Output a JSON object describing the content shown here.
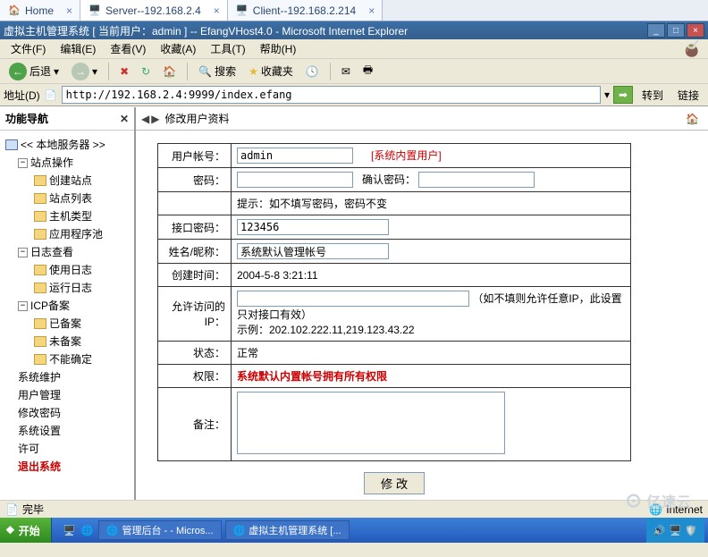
{
  "apptabs": {
    "home": "Home",
    "server": "Server--192.168.2.4",
    "client": "Client--192.168.2.214"
  },
  "titlebar": "虚拟主机管理系统 [ 当前用户：admin ] -- EfangVHost4.0 - Microsoft Internet Explorer",
  "menu": {
    "file": "文件(F)",
    "edit": "编辑(E)",
    "view": "查看(V)",
    "fav": "收藏(A)",
    "tools": "工具(T)",
    "help": "帮助(H)"
  },
  "toolbar": {
    "back": "后退",
    "stop": "",
    "refresh": "",
    "home": "",
    "search": "搜索",
    "fav": "收藏夹"
  },
  "addrbar": {
    "label": "地址(D)",
    "url": "http://192.168.2.4:9999/index.efang",
    "go": "转到",
    "links": "链接"
  },
  "leftpanel": {
    "title": "功能导航",
    "root": "<< 本地服务器 >>",
    "site_ops": "站点操作",
    "site_ops_items": [
      "创建站点",
      "站点列表",
      "主机类型",
      "应用程序池"
    ],
    "log": "日志查看",
    "log_items": [
      "使用日志",
      "运行日志"
    ],
    "icp": "ICP备案",
    "icp_items": [
      "已备案",
      "未备案",
      "不能确定"
    ],
    "flat": [
      "系统维护",
      "用户管理",
      "修改密码",
      "系统设置",
      "许可"
    ],
    "exit": "退出系统"
  },
  "rightpanel": {
    "title": "修改用户资料"
  },
  "form": {
    "user_label": "用户帐号：",
    "user_value": "admin",
    "builtin": "[系统内置用户]",
    "pwd_label": "密码：",
    "pwd2_label": "确认密码：",
    "pwd_hint": "提示：如不填写密码，密码不变",
    "api_label": "接口密码：",
    "api_value": "123456",
    "name_label": "姓名/昵称：",
    "name_value": "系统默认管理帐号",
    "create_label": "创建时间：",
    "create_value": "2004-5-8 3:21:11",
    "ip_label": "允许访问的IP：",
    "ip_hint": "（如不填则允许任意IP，此设置只对接口有效）",
    "ip_example": "示例：202.102.222.11,219.123.43.22",
    "status_label": "状态：",
    "status_value": "正常",
    "perm_label": "权限：",
    "perm_value": "系统默认内置帐号拥有所有权限",
    "note_label": "备注：",
    "submit": "修 改"
  },
  "statusbar": {
    "done": "完毕",
    "zone": "Internet"
  },
  "taskbar": {
    "start": "开始",
    "task1": "管理后台 - - Micros...",
    "task2": "虚拟主机管理系统 [..."
  },
  "watermark": "亿速云"
}
